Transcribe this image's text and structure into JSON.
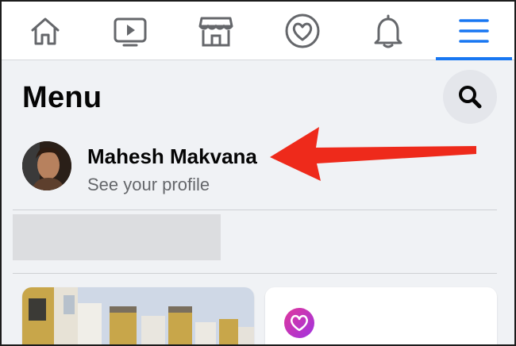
{
  "nav": {
    "items": [
      {
        "name": "home",
        "icon": "home-icon"
      },
      {
        "name": "watch",
        "icon": "video-icon"
      },
      {
        "name": "marketplace",
        "icon": "store-icon"
      },
      {
        "name": "dating",
        "icon": "heart-icon"
      },
      {
        "name": "notifications",
        "icon": "bell-icon"
      },
      {
        "name": "menu",
        "icon": "hamburger-icon",
        "active": true
      }
    ],
    "accent": "#1877f2"
  },
  "header": {
    "title": "Menu",
    "search_icon": "search-icon"
  },
  "profile": {
    "name": "Mahesh Makvana",
    "subtitle": "See your profile"
  },
  "annotation": {
    "arrow_color": "#ee2a1b",
    "points_to": "profile-name"
  },
  "cards": [
    {
      "name": "photo-card",
      "icon": "buildings-photo"
    },
    {
      "name": "dating-card",
      "icon": "dating-icon"
    }
  ]
}
